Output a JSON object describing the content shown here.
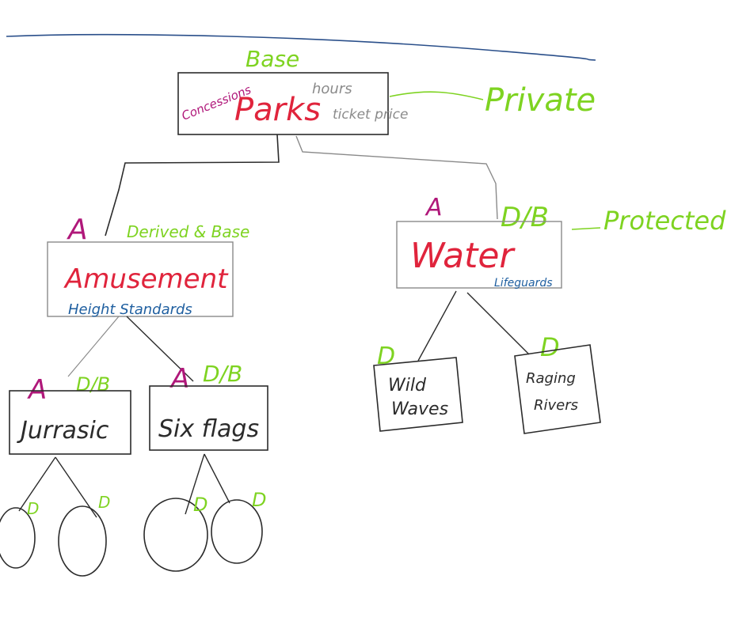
{
  "colors": {
    "ink": "#2b2b2b",
    "red": "#e0243c",
    "green": "#7ed321",
    "magenta": "#b0187a",
    "blue": "#1f5fa0",
    "gray": "#8a8a8a",
    "navy": "#2a4f8a"
  },
  "labels": {
    "base": "Base",
    "private": "Private",
    "protected": "Protected",
    "derived_base": "Derived & Base",
    "concessions": "Concessions",
    "hours": "hours",
    "ticket_price": "ticket price",
    "height_standards": "Height Standards",
    "lifeguards": "Lifeguards",
    "abstract_a": "A",
    "derived_d": "D",
    "db": "D/B"
  },
  "nodes": {
    "parks": "Parks",
    "amusement": "Amusement",
    "water": "Water",
    "jurassic": "Jurrasic",
    "six_flags": "Six flags",
    "wild_waves": "Wild Waves",
    "raging_rivers": "Raging Rivers"
  }
}
